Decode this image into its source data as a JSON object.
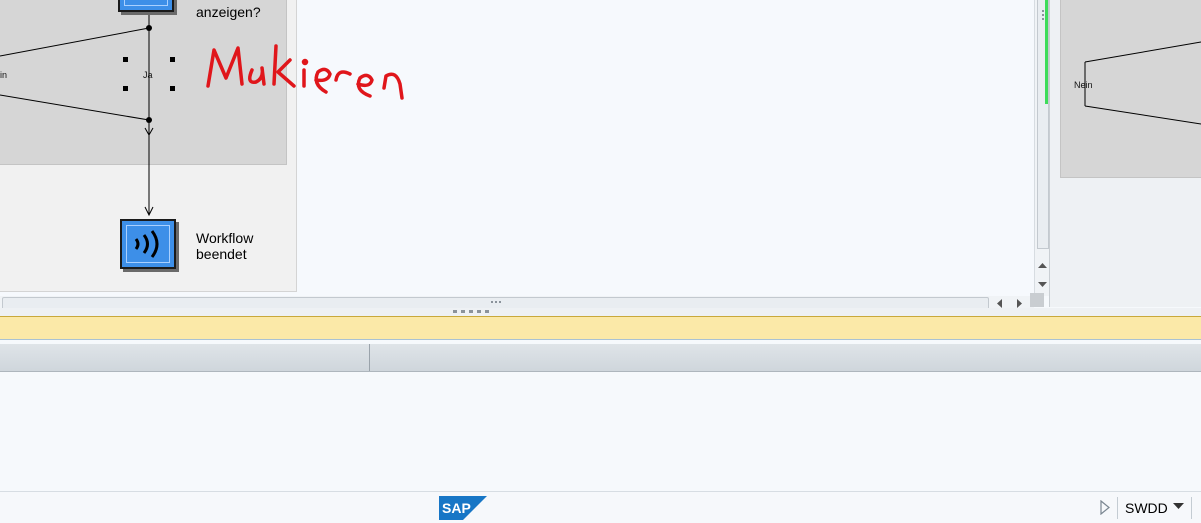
{
  "workflow": {
    "decision_step_label": "anzeigen?",
    "branch_yes": "Ja",
    "branch_no_left": "in",
    "end_step_label_line1": "Workflow",
    "end_step_label_line2": "beendet",
    "right_branch_no": "Nein"
  },
  "annotation": {
    "handwritten_text": "Markieren",
    "color": "#e0161b"
  },
  "status_bar": {
    "system_id": "SWDD",
    "logo_text": "SAP"
  },
  "colors": {
    "step_icon_blue": "#3d8fe8",
    "message_bar_yellow": "#fbe9a8",
    "scroll_highlight_green": "#3ddc5a"
  },
  "icons": [
    "workflow-step-icon",
    "workflow-end-icon",
    "scroll-up-icon",
    "scroll-down-icon",
    "scroll-left-icon",
    "scroll-right-icon",
    "play-triangle-icon",
    "dropdown-arrow-icon",
    "sap-logo"
  ]
}
